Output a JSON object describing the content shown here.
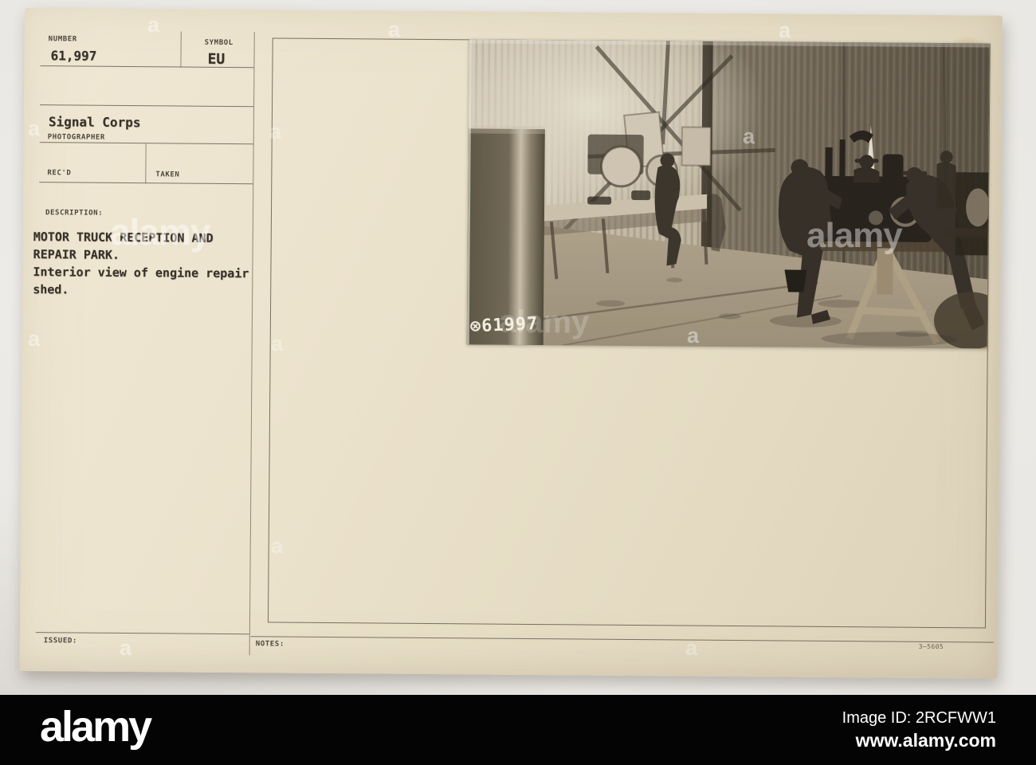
{
  "card": {
    "number": {
      "label": "NUMBER",
      "value": "61,997"
    },
    "symbol": {
      "label": "SYMBOL",
      "value": "EU"
    },
    "photographer": {
      "value": "Signal Corps",
      "label": "PHOTOGRAPHER"
    },
    "received": {
      "label": "REC'D"
    },
    "taken": {
      "label": "TAKEN"
    },
    "description": {
      "label": "DESCRIPTION:",
      "lines": [
        "MOTOR TRUCK RECEPTION AND",
        "REPAIR PARK.",
        "Interior view of engine repair",
        "shed."
      ]
    },
    "issued": {
      "label": "ISSUED:"
    },
    "notes": {
      "label": "NOTES:"
    },
    "print_code": "3—5605",
    "photo_stamp": "⊗61997"
  },
  "watermark": {
    "brand": "alamy",
    "letter": "a"
  },
  "bottom_bar": {
    "logo": "alamy",
    "image_id": "Image ID: 2RCFWW1",
    "url": "www.alamy.com"
  },
  "colors": {
    "card": "#eae1cb",
    "ink": "#37312a",
    "rule": "#5f564a",
    "bar_bg": "#040404",
    "page_bg": "#eae8e4",
    "photo_sepia": "#9a8f7d"
  }
}
